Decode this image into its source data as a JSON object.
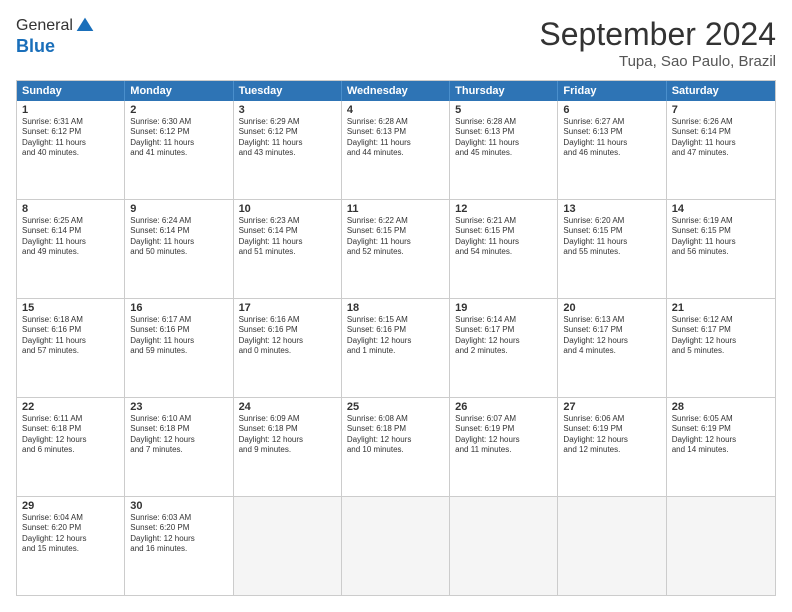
{
  "header": {
    "logo_general": "General",
    "logo_blue": "Blue",
    "month_year": "September 2024",
    "location": "Tupa, Sao Paulo, Brazil"
  },
  "weekdays": [
    "Sunday",
    "Monday",
    "Tuesday",
    "Wednesday",
    "Thursday",
    "Friday",
    "Saturday"
  ],
  "weeks": [
    [
      {
        "day": "1",
        "lines": [
          "Sunrise: 6:31 AM",
          "Sunset: 6:12 PM",
          "Daylight: 11 hours",
          "and 40 minutes."
        ]
      },
      {
        "day": "2",
        "lines": [
          "Sunrise: 6:30 AM",
          "Sunset: 6:12 PM",
          "Daylight: 11 hours",
          "and 41 minutes."
        ]
      },
      {
        "day": "3",
        "lines": [
          "Sunrise: 6:29 AM",
          "Sunset: 6:12 PM",
          "Daylight: 11 hours",
          "and 43 minutes."
        ]
      },
      {
        "day": "4",
        "lines": [
          "Sunrise: 6:28 AM",
          "Sunset: 6:13 PM",
          "Daylight: 11 hours",
          "and 44 minutes."
        ]
      },
      {
        "day": "5",
        "lines": [
          "Sunrise: 6:28 AM",
          "Sunset: 6:13 PM",
          "Daylight: 11 hours",
          "and 45 minutes."
        ]
      },
      {
        "day": "6",
        "lines": [
          "Sunrise: 6:27 AM",
          "Sunset: 6:13 PM",
          "Daylight: 11 hours",
          "and 46 minutes."
        ]
      },
      {
        "day": "7",
        "lines": [
          "Sunrise: 6:26 AM",
          "Sunset: 6:14 PM",
          "Daylight: 11 hours",
          "and 47 minutes."
        ]
      }
    ],
    [
      {
        "day": "8",
        "lines": [
          "Sunrise: 6:25 AM",
          "Sunset: 6:14 PM",
          "Daylight: 11 hours",
          "and 49 minutes."
        ]
      },
      {
        "day": "9",
        "lines": [
          "Sunrise: 6:24 AM",
          "Sunset: 6:14 PM",
          "Daylight: 11 hours",
          "and 50 minutes."
        ]
      },
      {
        "day": "10",
        "lines": [
          "Sunrise: 6:23 AM",
          "Sunset: 6:14 PM",
          "Daylight: 11 hours",
          "and 51 minutes."
        ]
      },
      {
        "day": "11",
        "lines": [
          "Sunrise: 6:22 AM",
          "Sunset: 6:15 PM",
          "Daylight: 11 hours",
          "and 52 minutes."
        ]
      },
      {
        "day": "12",
        "lines": [
          "Sunrise: 6:21 AM",
          "Sunset: 6:15 PM",
          "Daylight: 11 hours",
          "and 54 minutes."
        ]
      },
      {
        "day": "13",
        "lines": [
          "Sunrise: 6:20 AM",
          "Sunset: 6:15 PM",
          "Daylight: 11 hours",
          "and 55 minutes."
        ]
      },
      {
        "day": "14",
        "lines": [
          "Sunrise: 6:19 AM",
          "Sunset: 6:15 PM",
          "Daylight: 11 hours",
          "and 56 minutes."
        ]
      }
    ],
    [
      {
        "day": "15",
        "lines": [
          "Sunrise: 6:18 AM",
          "Sunset: 6:16 PM",
          "Daylight: 11 hours",
          "and 57 minutes."
        ]
      },
      {
        "day": "16",
        "lines": [
          "Sunrise: 6:17 AM",
          "Sunset: 6:16 PM",
          "Daylight: 11 hours",
          "and 59 minutes."
        ]
      },
      {
        "day": "17",
        "lines": [
          "Sunrise: 6:16 AM",
          "Sunset: 6:16 PM",
          "Daylight: 12 hours",
          "and 0 minutes."
        ]
      },
      {
        "day": "18",
        "lines": [
          "Sunrise: 6:15 AM",
          "Sunset: 6:16 PM",
          "Daylight: 12 hours",
          "and 1 minute."
        ]
      },
      {
        "day": "19",
        "lines": [
          "Sunrise: 6:14 AM",
          "Sunset: 6:17 PM",
          "Daylight: 12 hours",
          "and 2 minutes."
        ]
      },
      {
        "day": "20",
        "lines": [
          "Sunrise: 6:13 AM",
          "Sunset: 6:17 PM",
          "Daylight: 12 hours",
          "and 4 minutes."
        ]
      },
      {
        "day": "21",
        "lines": [
          "Sunrise: 6:12 AM",
          "Sunset: 6:17 PM",
          "Daylight: 12 hours",
          "and 5 minutes."
        ]
      }
    ],
    [
      {
        "day": "22",
        "lines": [
          "Sunrise: 6:11 AM",
          "Sunset: 6:18 PM",
          "Daylight: 12 hours",
          "and 6 minutes."
        ]
      },
      {
        "day": "23",
        "lines": [
          "Sunrise: 6:10 AM",
          "Sunset: 6:18 PM",
          "Daylight: 12 hours",
          "and 7 minutes."
        ]
      },
      {
        "day": "24",
        "lines": [
          "Sunrise: 6:09 AM",
          "Sunset: 6:18 PM",
          "Daylight: 12 hours",
          "and 9 minutes."
        ]
      },
      {
        "day": "25",
        "lines": [
          "Sunrise: 6:08 AM",
          "Sunset: 6:18 PM",
          "Daylight: 12 hours",
          "and 10 minutes."
        ]
      },
      {
        "day": "26",
        "lines": [
          "Sunrise: 6:07 AM",
          "Sunset: 6:19 PM",
          "Daylight: 12 hours",
          "and 11 minutes."
        ]
      },
      {
        "day": "27",
        "lines": [
          "Sunrise: 6:06 AM",
          "Sunset: 6:19 PM",
          "Daylight: 12 hours",
          "and 12 minutes."
        ]
      },
      {
        "day": "28",
        "lines": [
          "Sunrise: 6:05 AM",
          "Sunset: 6:19 PM",
          "Daylight: 12 hours",
          "and 14 minutes."
        ]
      }
    ],
    [
      {
        "day": "29",
        "lines": [
          "Sunrise: 6:04 AM",
          "Sunset: 6:20 PM",
          "Daylight: 12 hours",
          "and 15 minutes."
        ]
      },
      {
        "day": "30",
        "lines": [
          "Sunrise: 6:03 AM",
          "Sunset: 6:20 PM",
          "Daylight: 12 hours",
          "and 16 minutes."
        ]
      },
      {
        "day": "",
        "lines": []
      },
      {
        "day": "",
        "lines": []
      },
      {
        "day": "",
        "lines": []
      },
      {
        "day": "",
        "lines": []
      },
      {
        "day": "",
        "lines": []
      }
    ]
  ]
}
